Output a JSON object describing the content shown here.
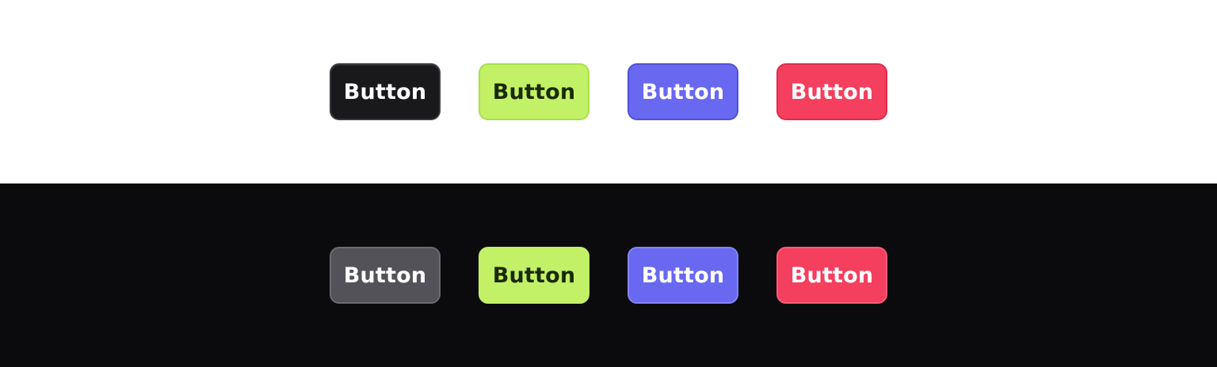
{
  "light_panel": {
    "background": "#ffffff",
    "buttons": [
      {
        "label": "Button",
        "variant": "neutral",
        "color": "#19191b"
      },
      {
        "label": "Button",
        "variant": "lime",
        "color": "#c2f067"
      },
      {
        "label": "Button",
        "variant": "indigo",
        "color": "#6868f0"
      },
      {
        "label": "Button",
        "variant": "rose",
        "color": "#f43f5e"
      }
    ]
  },
  "dark_panel": {
    "background": "#0b0b0d",
    "buttons": [
      {
        "label": "Button",
        "variant": "neutral",
        "color": "#525258"
      },
      {
        "label": "Button",
        "variant": "lime",
        "color": "#c2f067"
      },
      {
        "label": "Button",
        "variant": "indigo",
        "color": "#6868f0"
      },
      {
        "label": "Button",
        "variant": "rose",
        "color": "#f43f5e"
      }
    ]
  }
}
